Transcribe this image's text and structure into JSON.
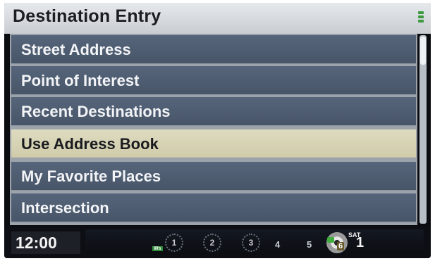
{
  "header": {
    "title": "Destination Entry",
    "signal_icon": "signal-strength-icon"
  },
  "menu": {
    "items": [
      {
        "label": "Street Address",
        "selected": false
      },
      {
        "label": "Point of Interest",
        "selected": false
      },
      {
        "label": "Recent Destinations",
        "selected": false
      },
      {
        "label": "Use Address Book",
        "selected": true
      },
      {
        "label": "My Favorite Places",
        "selected": false
      },
      {
        "label": "Intersection",
        "selected": false
      }
    ]
  },
  "status_bar": {
    "clock": "12:00",
    "ws_badge": "Ws",
    "presets": [
      "1",
      "2",
      "3",
      "4",
      "5"
    ],
    "active_preset": "6",
    "sat_label": "SAT",
    "sat_channel": "1"
  },
  "colors": {
    "list_item_bg": "#4f5d71",
    "selected_bg": "#d8d4b6",
    "header_bg": "#d8dce0",
    "status_bg": "#0d0e13"
  }
}
